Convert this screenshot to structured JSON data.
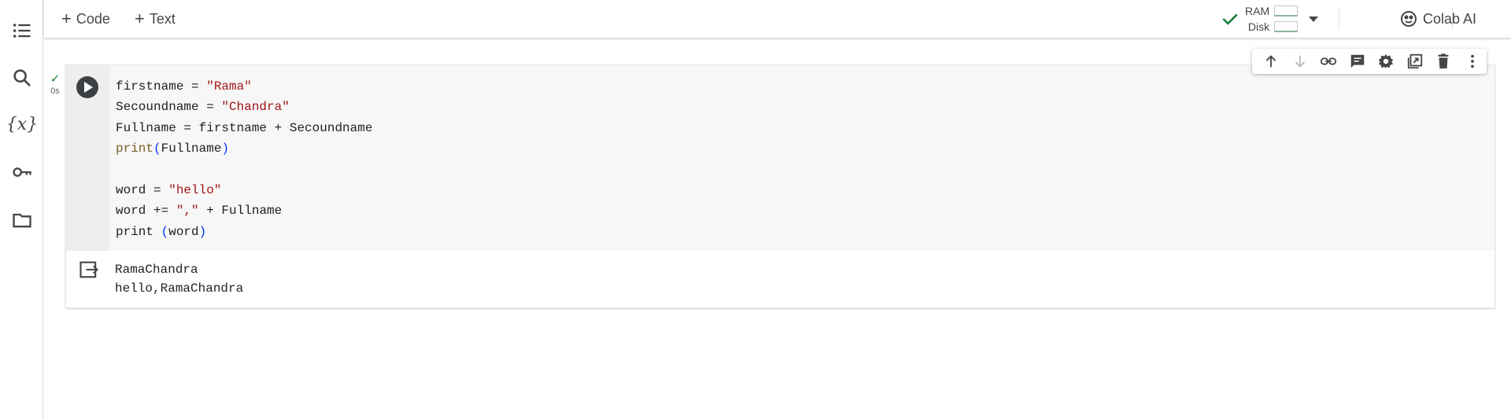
{
  "sidebar": {
    "items": [
      {
        "name": "table-of-contents-icon"
      },
      {
        "name": "search-icon"
      },
      {
        "name": "variables-icon",
        "label": "{x}"
      },
      {
        "name": "key-icon"
      },
      {
        "name": "folder-icon"
      }
    ]
  },
  "toolbar": {
    "add_code_label": "Code",
    "add_text_label": "Text",
    "ram_label": "RAM",
    "disk_label": "Disk",
    "colab_ai_label": "Colab AI"
  },
  "cell": {
    "status_time": "0s",
    "code_lines": [
      "firstname = \"Rama\"",
      "Secoundname = \"Chandra\"",
      "Fullname = firstname + Secoundname",
      "print(Fullname)",
      "",
      "word = \"hello\"",
      "word += \",\" + Fullname",
      "print (word)"
    ],
    "output_lines": [
      "RamaChandra",
      "hello,RamaChandra"
    ]
  },
  "colors": {
    "string": "#a31515",
    "function": "#795e26",
    "bracket": "#0431fa",
    "success": "#188038"
  }
}
